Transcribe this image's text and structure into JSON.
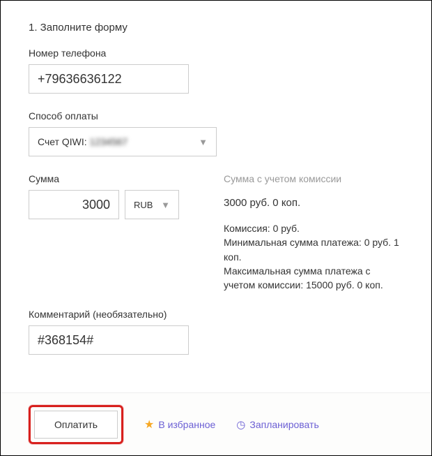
{
  "heading": "1. Заполните форму",
  "phone": {
    "label": "Номер телефона",
    "value": "+79636636122"
  },
  "method": {
    "label": "Способ оплаты",
    "text1": "Счет QIWI: ",
    "text2": "1234567"
  },
  "amount": {
    "label": "Сумма",
    "value": "3000",
    "currency": "RUB"
  },
  "info": {
    "total_label": "Сумма с учетом комиссии",
    "total_value": "3000 руб. 0 коп.",
    "commission": "Комиссия: 0 руб.",
    "min": "Минимальная сумма платежа: 0 руб. 1 коп.",
    "max": "Максимальная сумма платежа с учетом комиссии: 15000 руб. 0 коп."
  },
  "comment": {
    "label": "Комментарий (необязательно)",
    "value": "#368154#"
  },
  "buttons": {
    "pay": "Оплатить",
    "favorite": "В избранное",
    "schedule": "Запланировать"
  }
}
